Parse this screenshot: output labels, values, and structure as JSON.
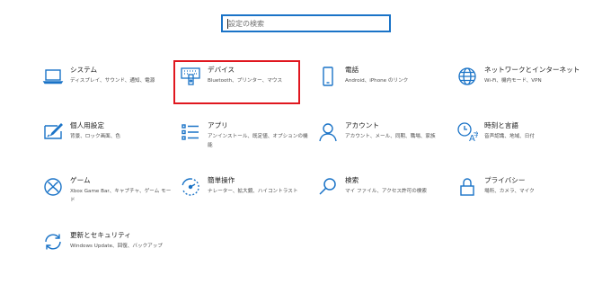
{
  "search": {
    "placeholder": "設定の検索"
  },
  "accent_color": "#1a73c7",
  "highlight_color": "#e0171f",
  "tiles": {
    "system": {
      "title": "システム",
      "desc": "ディスプレイ、サウンド、通知、電源",
      "icon": "laptop-icon"
    },
    "devices": {
      "title": "デバイス",
      "desc": "Bluetooth、プリンター、マウス",
      "icon": "keyboard-printer-icon"
    },
    "phone": {
      "title": "電話",
      "desc": "Android、iPhone のリンク",
      "icon": "phone-icon"
    },
    "network": {
      "title": "ネットワークとインターネット",
      "desc": "Wi-Fi、機内モード、VPN",
      "icon": "globe-icon"
    },
    "personalization": {
      "title": "個人用設定",
      "desc": "背景、ロック画面、色",
      "icon": "pen-display-icon"
    },
    "apps": {
      "title": "アプリ",
      "desc": "アンインストール、既定値、オプションの機能",
      "icon": "apps-list-icon"
    },
    "accounts": {
      "title": "アカウント",
      "desc": "アカウント、メール、同期、職場、家族",
      "icon": "person-icon"
    },
    "time_language": {
      "title": "時刻と言語",
      "desc": "音声認識、地域、日付",
      "icon": "clock-language-icon"
    },
    "gaming": {
      "title": "ゲーム",
      "desc": "Xbox Game Bar、キャプチャ、ゲーム モード",
      "icon": "xbox-icon"
    },
    "ease_of_access": {
      "title": "簡単操作",
      "desc": "ナレーター、拡大鏡、ハイコントラスト",
      "icon": "ease-of-access-icon"
    },
    "search_tile": {
      "title": "検索",
      "desc": "マイ ファイル、アクセス許可の検索",
      "icon": "magnifier-icon"
    },
    "privacy": {
      "title": "プライバシー",
      "desc": "場所、カメラ、マイク",
      "icon": "lock-icon"
    },
    "update_security": {
      "title": "更新とセキュリティ",
      "desc": "Windows Update、回復、バックアップ",
      "icon": "sync-icon"
    }
  },
  "selected_tile": "devices"
}
